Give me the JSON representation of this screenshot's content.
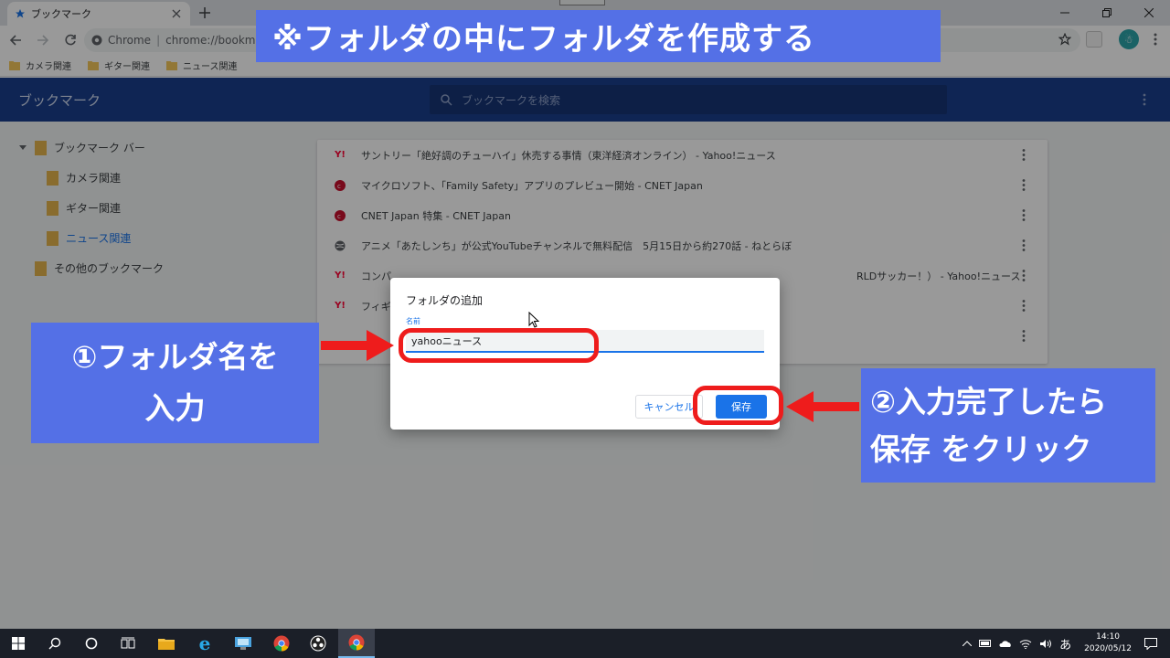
{
  "browser": {
    "tab_title": "ブックマーク",
    "omnibox_site": "Chrome",
    "omnibox_url": "chrome://bookmarks",
    "bookmarks_bar": [
      "カメラ関連",
      "ギター関連",
      "ニュース関連"
    ]
  },
  "manager": {
    "title": "ブックマーク",
    "search_placeholder": "ブックマークを検索",
    "tree": {
      "root": "ブックマーク バー",
      "children": [
        "カメラ関連",
        "ギター関連",
        "ニュース関連"
      ],
      "selected": "ニュース関連",
      "other": "その他のブックマーク"
    },
    "items": [
      {
        "title": "サントリー「絶好調のチューハイ」休売する事情（東洋経済オンライン） - Yahoo!ニュース",
        "favicon": "yahoo-icon"
      },
      {
        "title": "マイクロソフト、「Family Safety」アプリのプレビュー開始 - CNET Japan",
        "favicon": "cnet-icon"
      },
      {
        "title": "CNET Japan 特集 - CNET Japan",
        "favicon": "cnet-icon"
      },
      {
        "title": "アニメ「あたしンち」が公式YouTubeチャンネルで無料配信　5月15日から約270話 - ねとらぼ",
        "favicon": "globe-icon"
      },
      {
        "title": "コンバ…RLDサッカー！） - Yahoo!ニュース",
        "prefix": "コンパ",
        "suffix": "RLDサッカー！） - Yahoo!ニュース",
        "favicon": "yahoo-icon"
      },
      {
        "title": "フィギ…",
        "prefix": "フィギ",
        "favicon": "yahoo-icon"
      },
      {
        "title": "",
        "favicon": ""
      }
    ]
  },
  "dialog": {
    "title": "フォルダの追加",
    "name_label": "名前",
    "name_value": "yahooニュース",
    "cancel": "キャンセル",
    "save": "保存"
  },
  "annotations": {
    "top": "※フォルダの中にフォルダを作成する",
    "left_line1": "①フォルダ名を",
    "left_line2": "入力",
    "right_line1": "②入力完了したら",
    "right_line2": "保存 をクリック"
  },
  "taskbar": {
    "time": "14:10",
    "date": "2020/05/12",
    "ime": "あ"
  },
  "colors": {
    "annotation_bg": "#5470e6",
    "highlight": "#ee1c1c",
    "manager_header": "#1a3f8c",
    "accent": "#1a73e8"
  }
}
